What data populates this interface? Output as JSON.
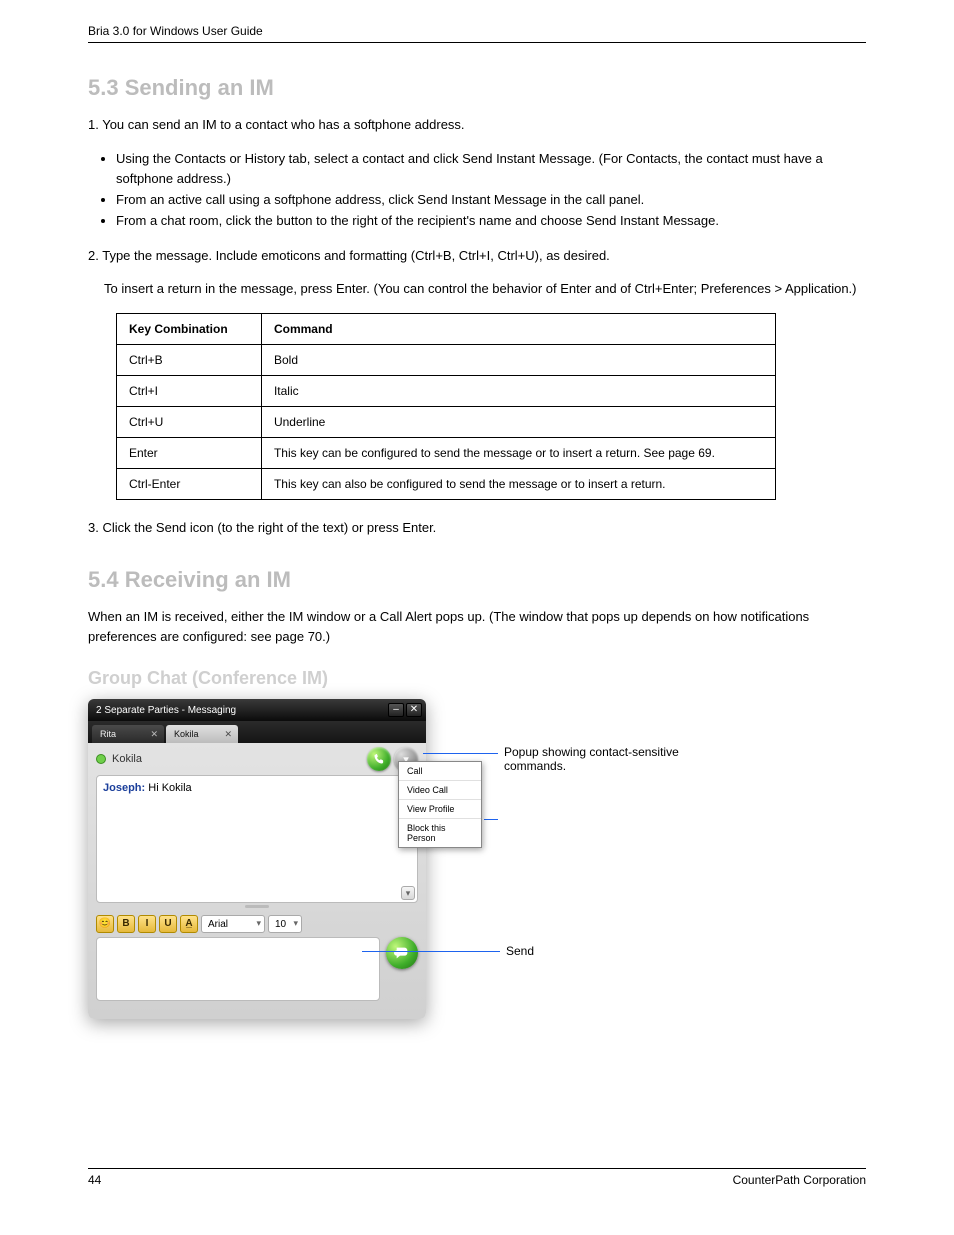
{
  "header": {
    "left": "Bria 3.0 for Windows User Guide",
    "right": ""
  },
  "footer": {
    "left": "44",
    "right": "CounterPath Corporation"
  },
  "sections": {
    "s1": {
      "title": "5.3 Sending an IM",
      "steps": [
        "Using the Contacts or History tab, select a contact and click Send Instant Message. (For Contacts, the contact must have a softphone address.)",
        "From an active call using a softphone address, click Send Instant Message in the call panel.",
        "From a chat room, click the button to the right of the recipient's name and choose Send Instant Message."
      ],
      "keymap_title": "Type the message. Include emoticons and formatting (Ctrl+B, Ctrl+I, Ctrl+U), as desired.",
      "keymap_note": "To insert a return in the message, press Enter. (You can control the behavior of Enter and of Ctrl+Enter; Preferences > Application.)",
      "keymap": [
        {
          "key": "Ctrl+B",
          "cmd": "Bold"
        },
        {
          "key": "Ctrl+I",
          "cmd": "Italic"
        },
        {
          "key": "Ctrl+U",
          "cmd": "Underline"
        },
        {
          "key": "Enter",
          "cmd": "This key can be configured to send the message or to insert a return. See page 69."
        },
        {
          "key": "Ctrl-Enter",
          "cmd": "This key can also be configured to send the message or to insert a return."
        }
      ],
      "send_step": "Click the Send icon (to the right of the text) or press Enter."
    },
    "s2": {
      "title": "5.4 Receiving an IM",
      "para": "When an IM is received, either the IM window or a Call Alert pops up. (The window that pops up depends on how notifications preferences are configured: see page 70.)"
    },
    "g": {
      "title": "Group Chat (Conference IM)"
    }
  },
  "messaging_window": {
    "title": "2 Separate Parties - Messaging",
    "tabs": [
      {
        "label": "Rita",
        "active": false
      },
      {
        "label": "Kokila",
        "active": true
      }
    ],
    "contact": "Kokila",
    "chat": {
      "sender": "Joseph:",
      "text": "Hi Kokila"
    },
    "menu": [
      "Call",
      "Video Call",
      "View Profile",
      "Block this Person"
    ],
    "font_family": "Arial",
    "font_size": "10",
    "format_buttons": [
      "😊",
      "B",
      "I",
      "U",
      "A̲"
    ],
    "compose_placeholder": ""
  },
  "callouts": {
    "a": "Popup showing contact-sensitive commands.",
    "b": "Send"
  }
}
